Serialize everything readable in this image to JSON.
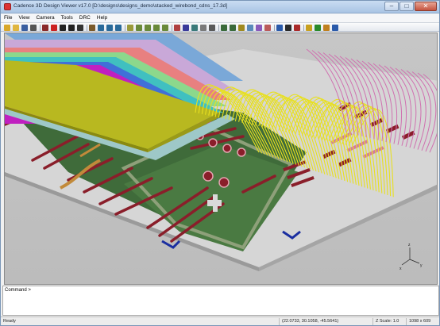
{
  "window": {
    "title": "Cadence 3D Design Viewer v17.0 [D:\\designs\\designs_demo\\stacked_wirebond_cdns_17.3d]",
    "buttons": {
      "minimize": "–",
      "maximize": "□",
      "close": "✕"
    }
  },
  "menu": {
    "items": [
      "File",
      "View",
      "Camera",
      "Tools",
      "DRC",
      "Help"
    ]
  },
  "toolbar": {
    "icons": [
      {
        "name": "open-icon",
        "color": "#d9a82a"
      },
      {
        "name": "folder-icon",
        "color": "#e0b640"
      },
      {
        "name": "save-icon",
        "color": "#3a5fa0"
      },
      {
        "name": "print-icon",
        "color": "#555555"
      },
      {
        "name": "settings-icon",
        "color": "#8a2a2a"
      },
      {
        "name": "record-icon",
        "color": "#cc2222"
      },
      {
        "name": "stop-icon",
        "color": "#222222"
      },
      {
        "name": "play-icon",
        "color": "#222222"
      },
      {
        "name": "camera-icon",
        "color": "#333333"
      },
      {
        "name": "export-image-icon",
        "color": "#7a5a2a"
      },
      {
        "name": "zoom-fit-icon",
        "color": "#2a6a9a"
      },
      {
        "name": "zoom-in-icon",
        "color": "#2a6a9a"
      },
      {
        "name": "zoom-out-icon",
        "color": "#2a6a9a"
      },
      {
        "name": "box-icon",
        "color": "#9a9a3a"
      },
      {
        "name": "view-top-icon",
        "color": "#6a8a3a"
      },
      {
        "name": "view-front-icon",
        "color": "#6a8a3a"
      },
      {
        "name": "view-side-icon",
        "color": "#6a8a3a"
      },
      {
        "name": "view-iso-icon",
        "color": "#6a8a3a"
      },
      {
        "name": "layer-icon",
        "color": "#b04040"
      },
      {
        "name": "wire-icon",
        "color": "#3a3a9a"
      },
      {
        "name": "net-icon",
        "color": "#3a7a7a"
      },
      {
        "name": "mesh-icon",
        "color": "#7a7a7a"
      },
      {
        "name": "grid-icon",
        "color": "#5a5a5a"
      },
      {
        "name": "rotate-icon",
        "color": "#3a6a3a"
      },
      {
        "name": "pan-icon",
        "color": "#3a6a3a"
      },
      {
        "name": "light-icon",
        "color": "#a08a20"
      },
      {
        "name": "transparency-icon",
        "color": "#5a8aba"
      },
      {
        "name": "clip-icon",
        "color": "#8a5aba"
      },
      {
        "name": "measure-icon",
        "color": "#ba5a5a"
      },
      {
        "name": "info-icon",
        "color": "#2a5aaa"
      },
      {
        "name": "properties-icon",
        "color": "#2a2a2a"
      },
      {
        "name": "drc-icon",
        "color": "#aa2a2a"
      },
      {
        "name": "highlight-icon",
        "color": "#c8a020"
      },
      {
        "name": "refresh-icon",
        "color": "#2a8a2a"
      },
      {
        "name": "pencil-icon",
        "color": "#c08020"
      },
      {
        "name": "help-icon",
        "color": "#2a5aaa"
      }
    ]
  },
  "viewport": {
    "axis": {
      "x": "x",
      "y": "y",
      "z": "z"
    }
  },
  "command": {
    "label": "Command >",
    "value": ""
  },
  "status": {
    "ready": "Ready",
    "coords": "(22.0733, 30.1058, -45.5641)",
    "zscale": "Z Scale: 1.0",
    "size": "1098 x 609"
  }
}
